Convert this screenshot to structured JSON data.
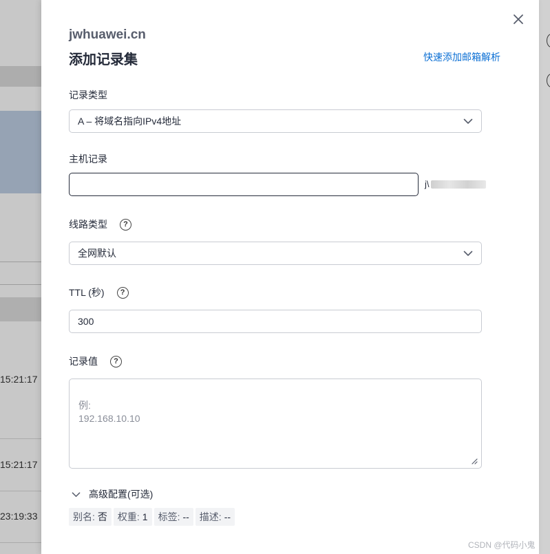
{
  "background": {
    "times": [
      "15:21:17",
      "15:21:17",
      "23:19:33"
    ]
  },
  "drawer": {
    "domain": "jwhuawei.cn",
    "title": "添加记录集",
    "quick_link": "快速添加邮箱解析",
    "record_type": {
      "label": "记录类型",
      "value": "A – 将域名指向IPv4地址"
    },
    "host": {
      "label": "主机记录",
      "value": "",
      "suffix_visible": "j\\"
    },
    "line_type": {
      "label": "线路类型",
      "value": "全网默认"
    },
    "ttl": {
      "label": "TTL (秒)",
      "value": "300"
    },
    "record_value": {
      "label": "记录值",
      "placeholder": "例:\n192.168.10.10"
    },
    "advanced": {
      "label": "高级配置(可选)",
      "tags": [
        {
          "key": "别名:",
          "value": "否"
        },
        {
          "key": "权重:",
          "value": "1"
        },
        {
          "key": "标签:",
          "value": "--"
        },
        {
          "key": "描述:",
          "value": "--"
        }
      ]
    },
    "help_glyph": "?"
  },
  "watermark": "CSDN @代码小鬼",
  "colors": {
    "link": "#0b6fd4",
    "text": "#252b3a",
    "border": "#c8cbd2"
  }
}
